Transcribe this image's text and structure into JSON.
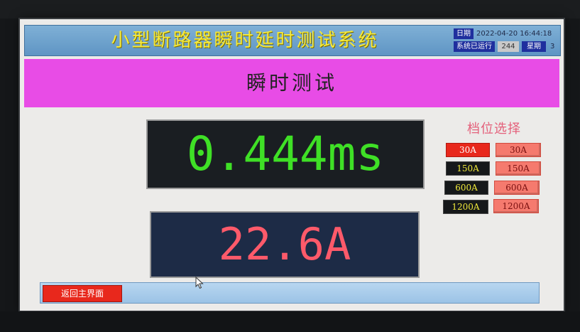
{
  "header": {
    "title": "小型断路器瞬时延时测试系统",
    "date_label": "日期",
    "date_value": "2022-04-20 16:44:18",
    "uptime_label": "系统已运行",
    "uptime_value": "244",
    "weekday_label": "星期",
    "weekday_value": "3"
  },
  "banner": {
    "title": "瞬时测试"
  },
  "readouts": {
    "time": "0.444ms",
    "current": "22.6A"
  },
  "gear": {
    "title": "档位选择",
    "rows": [
      {
        "left": "30A",
        "right": "30A"
      },
      {
        "left": "150A",
        "right": "150A"
      },
      {
        "left": "600A",
        "right": "600A"
      },
      {
        "left": "1200A",
        "right": "1200A"
      }
    ],
    "selected": "30A"
  },
  "footer": {
    "back_label": "返回主界面"
  },
  "colors": {
    "header_bg": "#6fa4d0",
    "title_text": "#f6ea3a",
    "banner_bg": "#e84ce6",
    "time_text": "#3fe026",
    "current_text": "#ff5a6a",
    "button_red": "#e8281c",
    "gear_title": "#e4607a"
  },
  "icons": {
    "cursor": "arrow-cursor-icon"
  }
}
